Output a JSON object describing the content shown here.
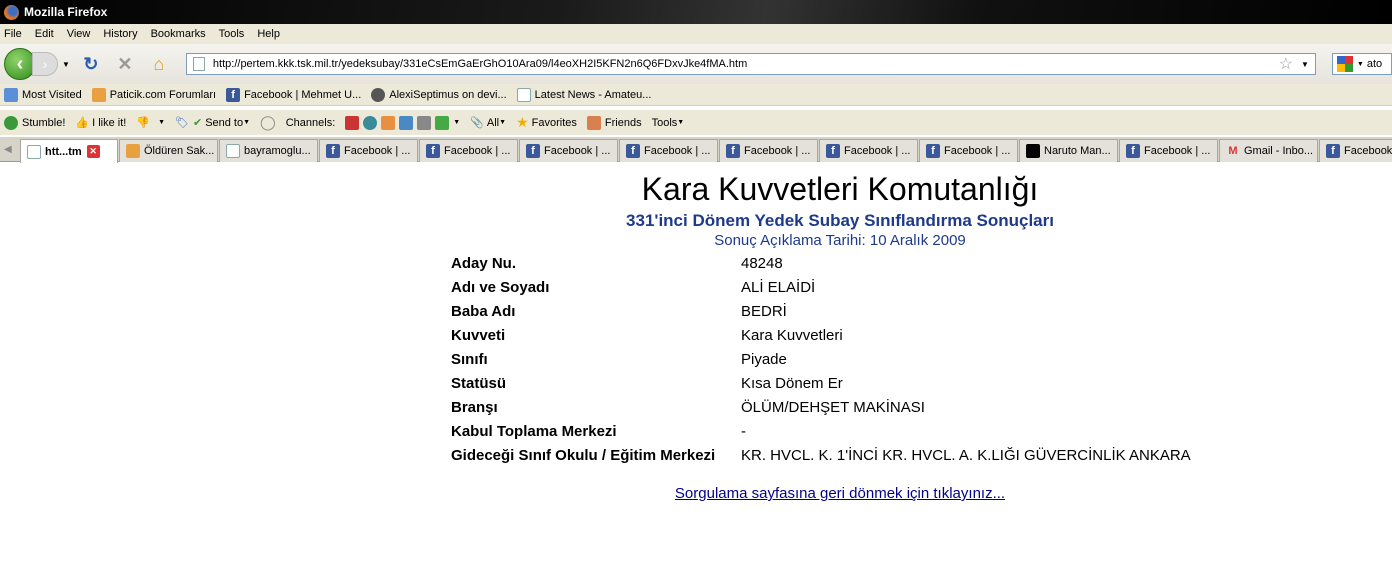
{
  "window": {
    "title": "Mozilla Firefox"
  },
  "menu": [
    "File",
    "Edit",
    "View",
    "History",
    "Bookmarks",
    "Tools",
    "Help"
  ],
  "address": {
    "url": "http://pertem.kkk.tsk.mil.tr/yedeksubay/331eCsEmGaErGhO10Ara09/l4eoXH2I5KFN2n6Q6FDxvJke4fMA.htm",
    "search_value": "ato"
  },
  "bookmarks": [
    "Most Visited",
    "Paticik.com Forumları",
    "Facebook | Mehmet U...",
    "AlexiSeptimus on devi...",
    "Latest News - Amateu..."
  ],
  "stumble": {
    "stumble": "Stumble!",
    "like": "I like it!",
    "send": "Send to",
    "channels": "Channels:",
    "all": "All",
    "favorites": "Favorites",
    "friends": "Friends",
    "tools": "Tools"
  },
  "tabs": [
    "htt...tm",
    "Öldüren Sak...",
    "bayramoglu...",
    "Facebook | ...",
    "Facebook | ...",
    "Facebook | ...",
    "Facebook | ...",
    "Facebook | ...",
    "Facebook | ...",
    "Facebook | ...",
    "Naruto Man...",
    "Facebook | ...",
    "Gmail - Inbo...",
    "Facebook"
  ],
  "page": {
    "title": "Kara Kuvvetleri Komutanlığı",
    "subtitle": "331'inci Dönem Yedek Subay Sınıflandırma Sonuçları",
    "date": "Sonuç Açıklama Tarihi: 10 Aralık 2009",
    "rows": [
      {
        "k": "Aday Nu.",
        "v": "48248"
      },
      {
        "k": "Adı ve Soyadı",
        "v": "ALİ ELAİDİ"
      },
      {
        "k": "Baba Adı",
        "v": "BEDRİ"
      },
      {
        "k": "Kuvveti",
        "v": "Kara Kuvvetleri"
      },
      {
        "k": "Sınıfı",
        "v": "Piyade"
      },
      {
        "k": "Statüsü",
        "v": "Kısa Dönem Er"
      },
      {
        "k": "Branşı",
        "v": "ÖLÜM/DEHŞET MAKİNASI"
      },
      {
        "k": "Kabul Toplama Merkezi",
        "v": "-"
      },
      {
        "k": "Gideceği Sınıf Okulu / Eğitim Merkezi",
        "v": "KR. HVCL. K. 1'İNCİ KR. HVCL. A. K.LIĞI GÜVERCİNLİK ANKARA"
      }
    ],
    "back_link": "Sorgulama sayfasına geri dönmek için tıklayınız..."
  }
}
